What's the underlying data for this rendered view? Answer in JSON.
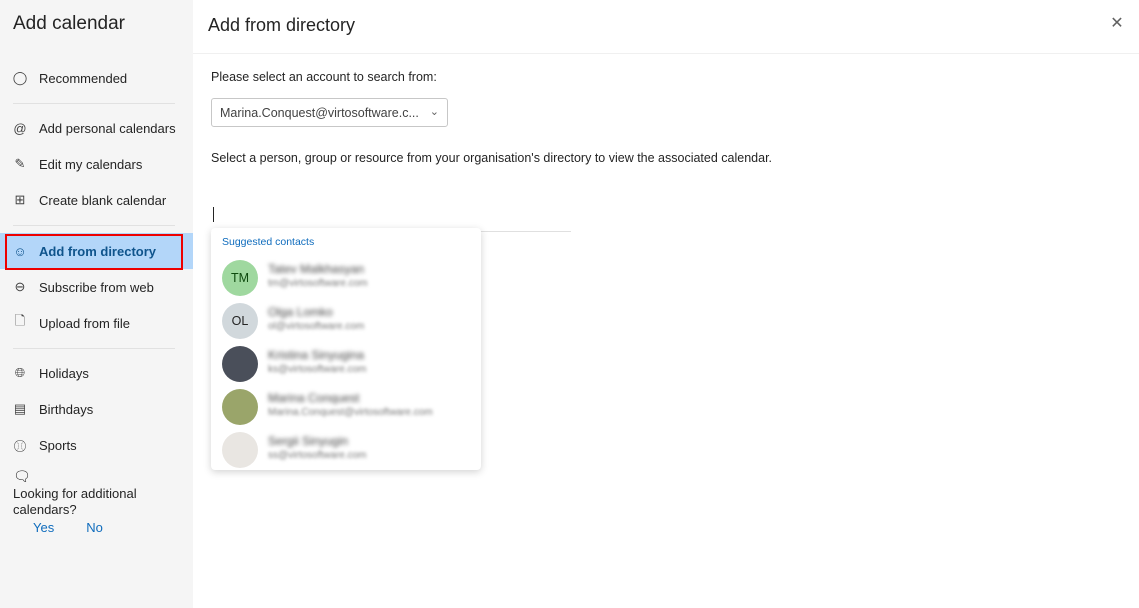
{
  "sidebar": {
    "title": "Add calendar",
    "items": [
      {
        "label": "Recommended",
        "icon": "lightbulb-icon"
      },
      {
        "label": "Add personal calendars",
        "icon": "at-icon"
      },
      {
        "label": "Edit my calendars",
        "icon": "edit-calendar-icon"
      },
      {
        "label": "Create blank calendar",
        "icon": "calendar-add-icon"
      },
      {
        "label": "Add from directory",
        "icon": "people-icon"
      },
      {
        "label": "Subscribe from web",
        "icon": "link-circle-icon"
      },
      {
        "label": "Upload from file",
        "icon": "file-add-icon"
      },
      {
        "label": "Holidays",
        "icon": "globe-icon"
      },
      {
        "label": "Birthdays",
        "icon": "cake-icon"
      },
      {
        "label": "Sports",
        "icon": "sports-ball-icon"
      }
    ],
    "selected": "Add from directory",
    "feedback": {
      "question": "Looking for additional calendars?",
      "yes": "Yes",
      "no": "No"
    }
  },
  "main": {
    "title": "Add from directory",
    "account_label": "Please select an account to search from:",
    "account_value": "Marina.Conquest@virtosoftware.c...",
    "instructions": "Select a person, group or resource from your organisation's directory to view the associated calendar.",
    "search_value": "",
    "suggestions": {
      "heading": "Suggested contacts",
      "contacts": [
        {
          "initials": "TM",
          "name": "Tatev Malkhasyan",
          "email": "tm@virtosoftware.com",
          "avatar_color": "#9fd89f"
        },
        {
          "initials": "OL",
          "name": "Olga Lomko",
          "email": "ol@virtosoftware.com",
          "avatar_color": "#d1d8dc"
        },
        {
          "initials": "",
          "name": "Kristina Sinyugina",
          "email": "ks@virtosoftware.com",
          "avatar_color": "#4a4f5a"
        },
        {
          "initials": "",
          "name": "Marina Conquest",
          "email": "Marina.Conquest@virtosoftware.com",
          "avatar_color": "#9aa56a"
        },
        {
          "initials": "",
          "name": "Sergii Sinyugin",
          "email": "ss@virtosoftware.com",
          "avatar_color": "#e9e6e2"
        }
      ]
    }
  },
  "colors": {
    "accent": "#0f6cbd",
    "selected_bg": "#b3d6f9",
    "highlight": "#ee0000"
  }
}
